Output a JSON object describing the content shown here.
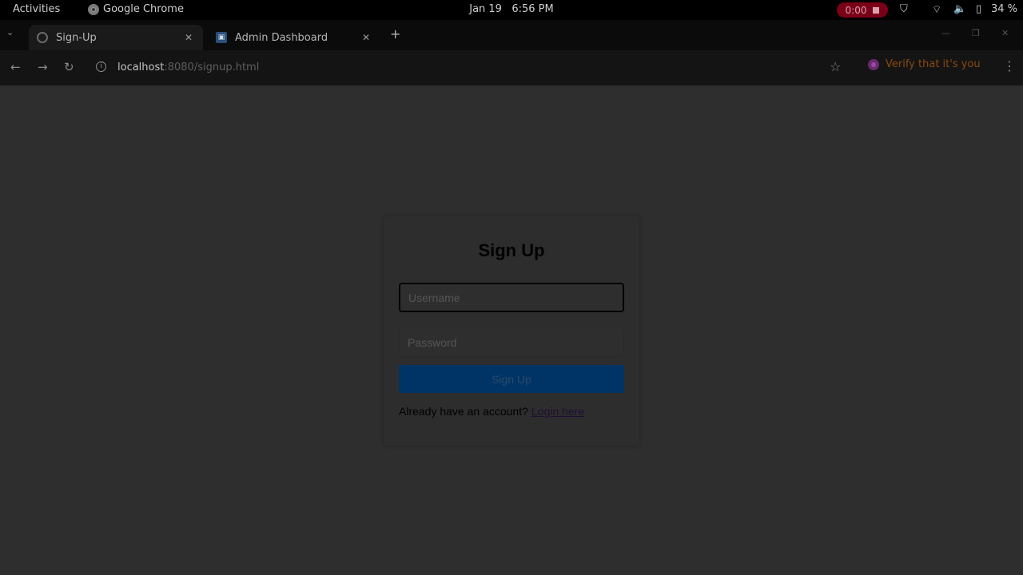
{
  "system_bar": {
    "activities": "Activities",
    "app_name": "Google Chrome",
    "date": "Jan 19",
    "time": "6:56 PM",
    "recording_time": "0:00",
    "battery": "34 %"
  },
  "tabs": [
    {
      "label": "Sign-Up",
      "active": true,
      "favicon": "globe-icon"
    },
    {
      "label": "Admin Dashboard",
      "active": false,
      "favicon": "app-icon"
    }
  ],
  "address_bar": {
    "host": "localhost",
    "path": ":8080/signup.html"
  },
  "profile": {
    "verify_label": "Verify that it's you"
  },
  "signup_form": {
    "title": "Sign Up",
    "username_placeholder": "Username",
    "password_placeholder": "Password",
    "submit_label": "Sign Up",
    "login_prompt": "Already have an account?",
    "login_link": "Login here"
  },
  "colors": {
    "page_bg": "#2e2e2e",
    "button_bg": "#003366",
    "recording_bg": "#7a0018"
  }
}
